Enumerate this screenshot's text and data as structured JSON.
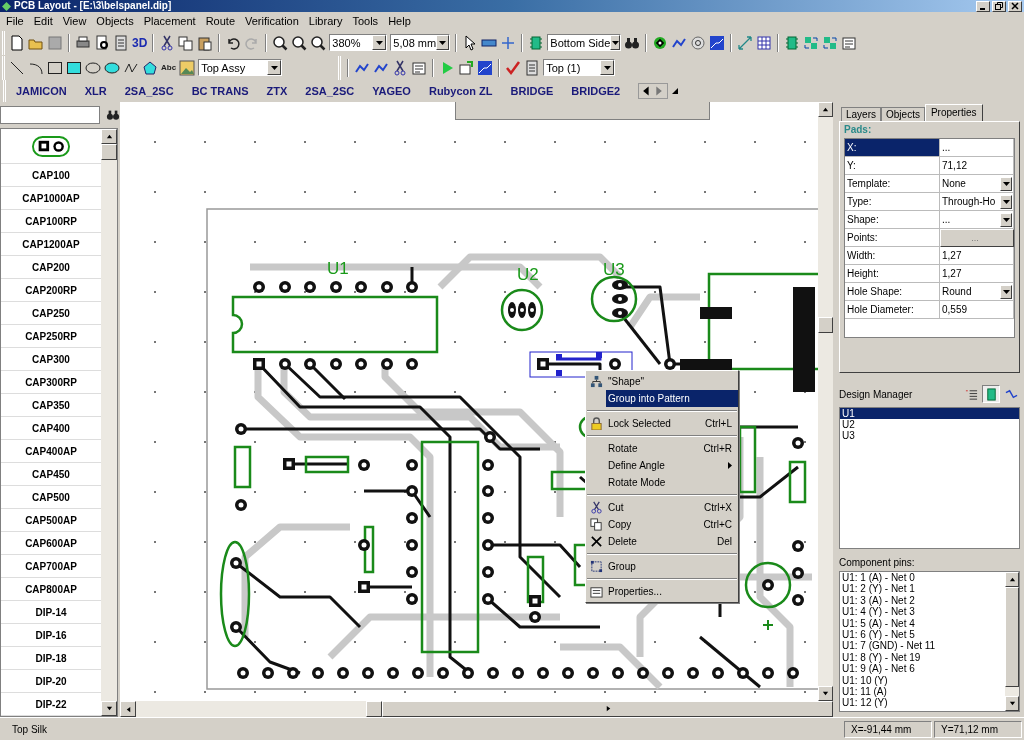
{
  "window": {
    "title": "PCB Layout - [E:\\3\\belspanel.dip]"
  },
  "menu": [
    "File",
    "Edit",
    "View",
    "Objects",
    "Placement",
    "Route",
    "Verification",
    "Library",
    "Tools",
    "Help"
  ],
  "toolbar_1": {
    "view_3d": "3D",
    "zoom": "380%",
    "grid": "5,08 mm",
    "side": "Bottom Side"
  },
  "toolbar_2": {
    "text_tool": "Abc",
    "layer": "Top Assy",
    "copper_layer": "Top (1)"
  },
  "library_tabs": [
    "JAMICON",
    "XLR",
    "2SA_2SC",
    "BC TRANS",
    "ZTX",
    "2SA_2SC",
    "YAGEO",
    "Rubycon ZL",
    "BRIDGE",
    "BRIDGE2"
  ],
  "components": [
    "CAP100",
    "CAP1000AP",
    "CAP100RP",
    "CAP1200AP",
    "CAP200",
    "CAP200RP",
    "CAP250",
    "CAP250RP",
    "CAP300",
    "CAP300RP",
    "CAP350",
    "CAP400",
    "CAP400AP",
    "CAP450",
    "CAP500",
    "CAP500AP",
    "CAP600AP",
    "CAP700AP",
    "CAP800AP",
    "DIP-14",
    "DIP-16",
    "DIP-18",
    "DIP-20",
    "DIP-22"
  ],
  "canvas": {
    "labels": [
      "U1",
      "U2",
      "U3"
    ]
  },
  "context_menu": [
    {
      "kind": "item",
      "label": "\"Shape\"",
      "selected": false
    },
    {
      "kind": "item",
      "label": "Group into Pattern",
      "selected": true
    },
    {
      "kind": "separator"
    },
    {
      "kind": "item",
      "label": "Lock Selected",
      "shortcut": "Ctrl+L",
      "selected": false
    },
    {
      "kind": "separator"
    },
    {
      "kind": "item",
      "label": "Rotate",
      "shortcut": "Ctrl+R",
      "selected": false
    },
    {
      "kind": "item",
      "label": "Define Angle",
      "submenu": true,
      "selected": false
    },
    {
      "kind": "item",
      "label": "Rotate Mode",
      "selected": false
    },
    {
      "kind": "separator"
    },
    {
      "kind": "item",
      "label": "Cut",
      "shortcut": "Ctrl+X",
      "selected": false
    },
    {
      "kind": "item",
      "label": "Copy",
      "shortcut": "Ctrl+C",
      "selected": false
    },
    {
      "kind": "item",
      "label": "Delete",
      "shortcut": "Del",
      "selected": false
    },
    {
      "kind": "separator"
    },
    {
      "kind": "item",
      "label": "Group",
      "selected": false
    },
    {
      "kind": "separator"
    },
    {
      "kind": "item",
      "label": "Properties...",
      "selected": false
    }
  ],
  "panel_tabs": [
    {
      "label": "Layers",
      "selected": false
    },
    {
      "label": "Objects",
      "selected": false
    },
    {
      "label": "Properties",
      "selected": true
    }
  ],
  "properties": {
    "heading": "Pads:",
    "rows": [
      {
        "label": "X:",
        "value": "...",
        "kind": "text",
        "selected": true
      },
      {
        "label": "Y:",
        "value": "71,12",
        "kind": "text",
        "selected": false
      },
      {
        "label": "Template:",
        "value": "None",
        "kind": "select",
        "selected": false
      },
      {
        "label": "Type:",
        "value": "Through-Ho",
        "kind": "select",
        "selected": false
      },
      {
        "label": "Shape:",
        "value": "...",
        "kind": "select",
        "selected": false
      },
      {
        "label": "Points:",
        "value": "...",
        "kind": "button",
        "selected": false
      },
      {
        "label": "Width:",
        "value": "1,27",
        "kind": "text",
        "selected": false
      },
      {
        "label": "Height:",
        "value": "1,27",
        "kind": "text",
        "selected": false
      },
      {
        "label": "Hole Shape:",
        "value": "Round",
        "kind": "select",
        "selected": false
      },
      {
        "label": "Hole Diameter:",
        "value": "0,559",
        "kind": "text",
        "selected": false
      }
    ]
  },
  "design_manager": {
    "title": "Design Manager",
    "modes": [
      {
        "selected": false
      },
      {
        "selected": true
      },
      {
        "selected": false
      }
    ],
    "items": [
      {
        "label": "U1",
        "selected": true
      },
      {
        "label": "U2",
        "selected": false
      },
      {
        "label": "U3",
        "selected": false
      }
    ],
    "pins_label": "Component pins:",
    "pins": [
      "U1: 1 (A) - Net 0",
      "U1: 2 (Y) - Net 1",
      "U1: 3 (A) - Net 2",
      "U1: 4 (Y) - Net 3",
      "U1: 5 (A) - Net 4",
      "U1: 6 (Y) - Net 5",
      "U1: 7 (GND) - Net 11",
      "U1: 8 (Y) - Net 19",
      "U1: 9 (A) - Net 6",
      "U1: 10 (Y)",
      "U1: 11 (A)",
      "U1: 12 (Y)"
    ]
  },
  "status_bar": {
    "layer": "Top Silk",
    "x": "X=-91,44 mm",
    "y": "Y=71,12 mm"
  }
}
